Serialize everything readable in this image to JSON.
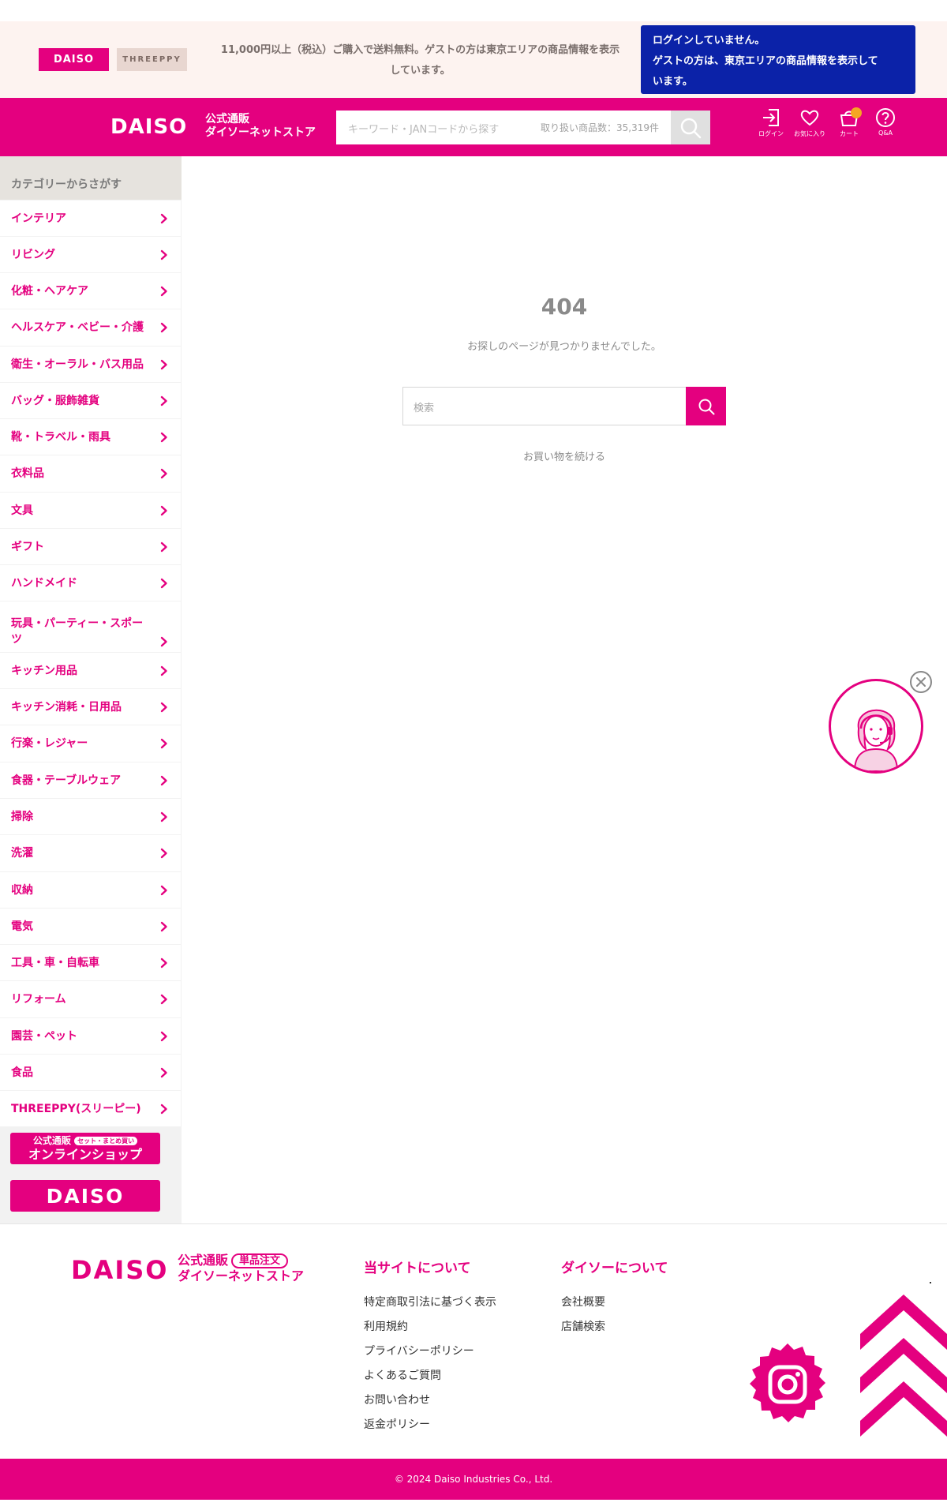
{
  "topbar": {
    "daiso_logo": "DAISO",
    "threeppy_logo": "THREEPPY",
    "notice_line1": "11,000円以上（税込）ご購入で送料無料。ゲストの方は東京エリアの商品情報を表示",
    "notice_line2": "しています。",
    "login_status_line1": "ログインしていません。",
    "login_status_line2": "ゲストの方は、東京エリアの商品情報を表示して",
    "login_status_line3": "います。"
  },
  "header": {
    "brand": "DAISO",
    "brand_sub_line1": "公式通販",
    "brand_sub_line2": "ダイソーネットストア",
    "search_placeholder": "キーワード・JANコードから探す",
    "item_count": "取り扱い商品数：35,319件",
    "icons": [
      {
        "name": "login-icon",
        "label": "ログイン"
      },
      {
        "name": "heart-icon",
        "label": "お気に入り"
      },
      {
        "name": "cart-icon",
        "label": "カート"
      },
      {
        "name": "help-icon",
        "label": "Q&A"
      }
    ],
    "colors": {
      "brand": "#e4007f",
      "login_box": "#0b22a8",
      "cart_badge": "#f5a623"
    }
  },
  "sidebar": {
    "title": "カテゴリーからさがす",
    "categories": [
      "インテリア",
      "リビング",
      "化粧・ヘアケア",
      "ヘルスケア・ベビー・介護",
      "衛生・オーラル・バス用品",
      "バッグ・服飾雑貨",
      "靴・トラベル・雨具",
      "衣料品",
      "文具",
      "ギフト",
      "ハンドメイド",
      "玩具・パーティー・スポーツ",
      "キッチン用品",
      "キッチン消耗・日用品",
      "行楽・レジャー",
      "食器・テーブルウェア",
      "掃除",
      "洗濯",
      "収納",
      "電気",
      "工具・車・自転車",
      "リフォーム",
      "園芸・ペット",
      "食品",
      "THREEPPY(スリーピー)"
    ],
    "banner_online_line1": "公式通販",
    "banner_online_pill": "セット・まとめ買い",
    "banner_online_line2": "オンラインショップ",
    "banner_daiso": "DAISO"
  },
  "main": {
    "error_code": "404",
    "error_message": "お探しのページが見つかりませんでした。",
    "search_placeholder": "検索",
    "continue_link": "お買い物を続ける"
  },
  "footer": {
    "brand": "DAISO",
    "brand_sub_line1": "公式通販",
    "brand_sub_pill": "単品注文",
    "brand_sub_line2": "ダイソーネットストア",
    "col1_title": "当サイトについて",
    "col1_links": [
      "特定商取引法に基づく表示",
      "利用規約",
      "プライバシーポリシー",
      "よくあるご質問",
      "お問い合わせ",
      "返金ポリシー"
    ],
    "col2_title": "ダイソーについて",
    "col2_links": [
      "会社概要",
      "店舗検索"
    ],
    "copyright": "© 2024 Daiso Industries Co., Ltd."
  }
}
